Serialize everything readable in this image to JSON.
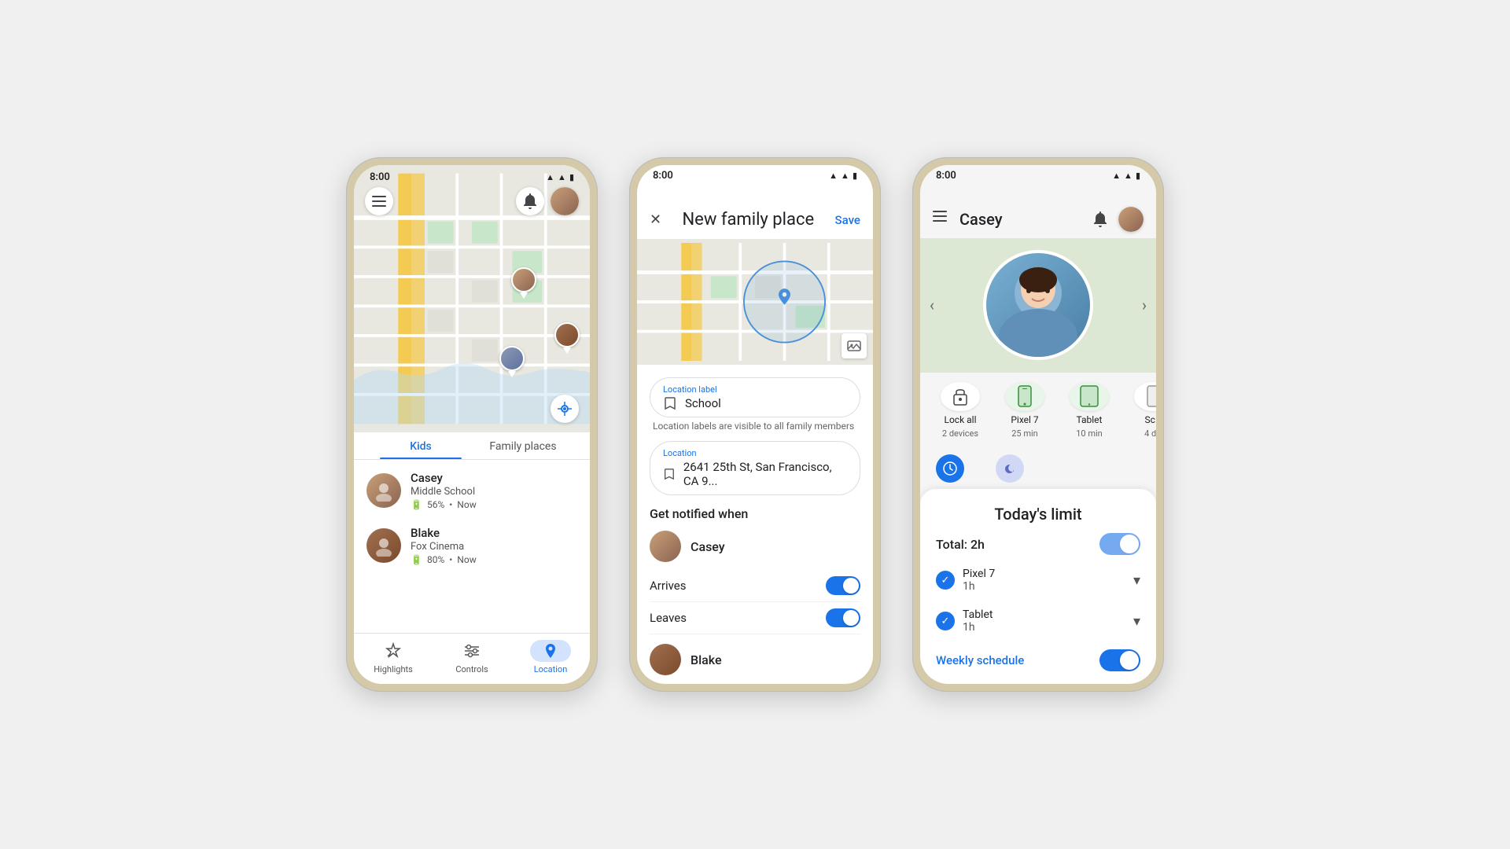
{
  "phones": [
    {
      "id": "phone1",
      "status_time": "8:00",
      "tabs": [
        "Kids",
        "Family places"
      ],
      "active_tab": 0,
      "members": [
        {
          "name": "Casey",
          "location": "Middle School",
          "battery": "56%",
          "status": "Now",
          "avatar_color": "#c9a07a"
        },
        {
          "name": "Blake",
          "location": "Fox Cinema",
          "battery": "80%",
          "status": "Now",
          "avatar_color": "#9b7a5a"
        }
      ],
      "nav_items": [
        "Highlights",
        "Controls",
        "Location"
      ],
      "active_nav": 2
    },
    {
      "id": "phone2",
      "status_time": "8:00",
      "title": "New family place",
      "save_label": "Save",
      "location_label_field_label": "Location label",
      "location_label_value": "School",
      "location_hint": "Location labels are visible to all family members",
      "location_field_label": "Location",
      "location_value": "2641 25th St, San Francisco, CA 9...",
      "notify_title": "Get notified when",
      "person_name": "Casey",
      "toggle1_label": "Arrives",
      "toggle2_label": "Leaves",
      "person2_name": "Blake"
    },
    {
      "id": "phone3",
      "status_time": "8:00",
      "header_name": "Casey",
      "devices": [
        {
          "name": "Lock all",
          "sub": "2 devices"
        },
        {
          "name": "Pixel 7",
          "sub": "25 min"
        },
        {
          "name": "Tablet",
          "sub": "10 min"
        },
        {
          "name": "Sc...",
          "sub": "4 d..."
        }
      ],
      "sheet_title": "Today's limit",
      "total_label": "Total: 2h",
      "device_rows": [
        {
          "name": "Pixel 7",
          "hours": "1h"
        },
        {
          "name": "Tablet",
          "hours": "1h"
        }
      ],
      "weekly_label": "Weekly schedule"
    }
  ]
}
